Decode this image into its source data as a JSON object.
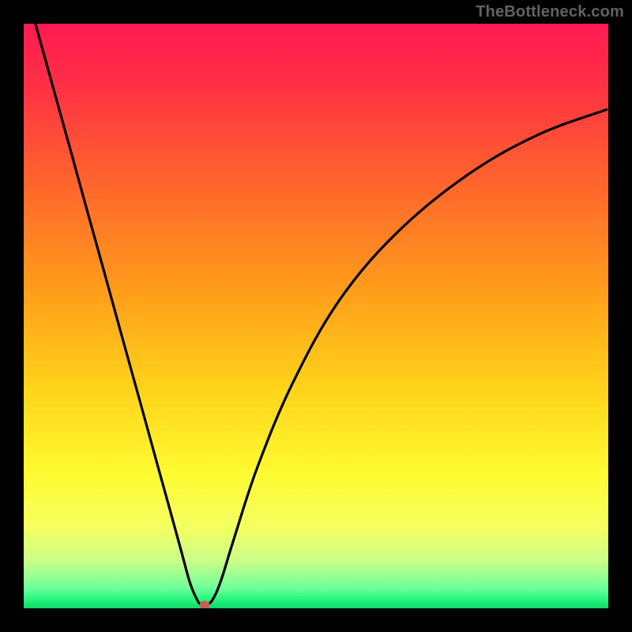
{
  "watermark": "TheBottleneck.com",
  "colors": {
    "frame": "#000000",
    "curve": "#000000",
    "marker": "#cb5d51",
    "gradient_stops": [
      {
        "offset": 0.0,
        "color": "#ff1a53"
      },
      {
        "offset": 0.1,
        "color": "#ff2e45"
      },
      {
        "offset": 0.25,
        "color": "#ff5e2f"
      },
      {
        "offset": 0.45,
        "color": "#ff9b1b"
      },
      {
        "offset": 0.62,
        "color": "#ffd21a"
      },
      {
        "offset": 0.77,
        "color": "#fffb31"
      },
      {
        "offset": 0.86,
        "color": "#f5ff60"
      },
      {
        "offset": 0.92,
        "color": "#c8ff89"
      },
      {
        "offset": 0.965,
        "color": "#70ff9a"
      },
      {
        "offset": 0.985,
        "color": "#26f57e"
      },
      {
        "offset": 1.0,
        "color": "#0fd868"
      }
    ]
  },
  "chart_data": {
    "type": "line",
    "title": "",
    "xlabel": "",
    "ylabel": "",
    "xlim": [
      0,
      100
    ],
    "ylim": [
      0,
      100
    ],
    "grid": false,
    "legend": false,
    "series": [
      {
        "name": "bottleneck-curve",
        "x": [
          2,
          5,
          8,
          11,
          14,
          17,
          20,
          23,
          25,
          27,
          28.5,
          29.8,
          30.5,
          31,
          31.6,
          32.2,
          33,
          34,
          36,
          40,
          46,
          54,
          64,
          76,
          88,
          99.7
        ],
        "y": [
          100,
          89.2,
          78.4,
          67.5,
          56.7,
          45.8,
          35.0,
          24.1,
          16.9,
          9.6,
          4.2,
          1.2,
          0.6,
          0.5,
          0.7,
          1.3,
          2.8,
          5.5,
          12.0,
          24.2,
          38.5,
          52.7,
          64.4,
          74.2,
          81.0,
          85.3
        ]
      }
    ],
    "markers": [
      {
        "name": "minimum-point",
        "x": 31,
        "y": 0.5,
        "color": "#cb5d51"
      }
    ],
    "annotations": []
  }
}
